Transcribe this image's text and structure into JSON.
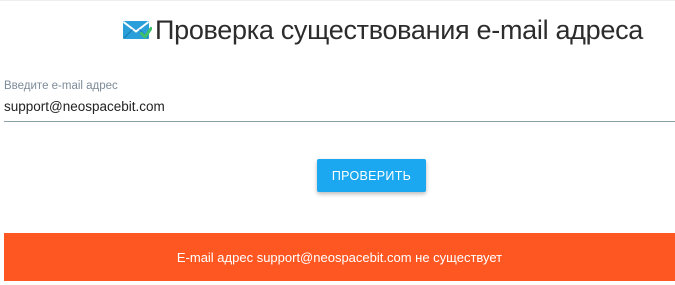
{
  "header": {
    "icon": "envelope-check-icon",
    "title": "Проверка существования e-mail адреса"
  },
  "form": {
    "email_label": "Введите e-mail адрес",
    "email_value": "support@neospacebit.com",
    "submit_label": "ПРОВЕРИТЬ"
  },
  "result": {
    "message": "E-mail адрес support@neospacebit.com не существует",
    "status": "error"
  },
  "colors": {
    "accent": "#1ba8f0",
    "error": "#ff5722",
    "icon_envelope": "#2b9fd9",
    "icon_check": "#3ec16a"
  }
}
